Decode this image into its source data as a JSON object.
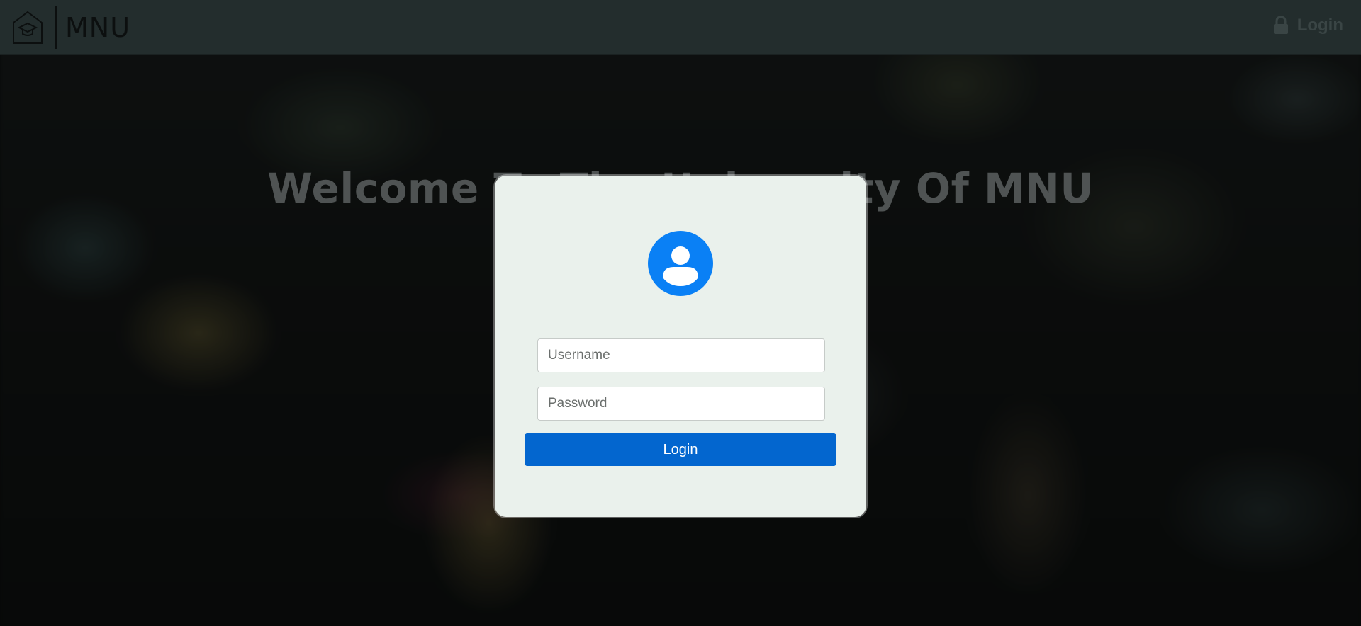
{
  "header": {
    "brand_name": "MNU",
    "brand_icon": "graduation-house-icon",
    "login_label": "Login",
    "login_icon": "lock-icon"
  },
  "hero": {
    "welcome_text": "Welcome To The University Of MNU"
  },
  "login_form": {
    "avatar_icon": "user-avatar-icon",
    "username": {
      "value": "",
      "placeholder": "Username"
    },
    "password": {
      "value": "",
      "placeholder": "Password"
    },
    "submit_label": "Login"
  },
  "colors": {
    "header_bg": "#232d2d",
    "card_bg": "#eaf1ec",
    "accent": "#0366cf",
    "avatar": "#0a80f5"
  }
}
